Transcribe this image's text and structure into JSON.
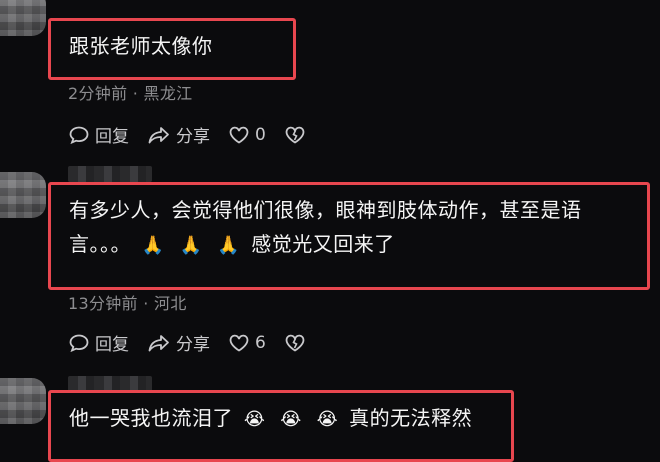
{
  "comments": [
    {
      "text": "跟张老师太像你",
      "meta": "2分钟前 · 黑龙江",
      "reply_label": "回复",
      "share_label": "分享",
      "like_count": "0"
    },
    {
      "text": "有多少人，会觉得他们很像，眼神到肢体动作，甚至是语",
      "text_line2_prefix": "言。。。",
      "emoji": "🙏",
      "text_line2_suffix": "感觉光又回来了",
      "meta": "13分钟前 · 河北",
      "reply_label": "回复",
      "share_label": "分享",
      "like_count": "6"
    },
    {
      "text_prefix": "他一哭我也流泪了",
      "emoji": "😭",
      "text_suffix": "真的无法释然"
    }
  ],
  "colors": {
    "highlight_border": "#e8474f",
    "background": "#0b0b0d",
    "meta_text": "#8d8d90"
  },
  "icons": [
    "comment-bubble-icon",
    "share-arrow-icon",
    "heart-icon",
    "broken-heart-icon"
  ]
}
